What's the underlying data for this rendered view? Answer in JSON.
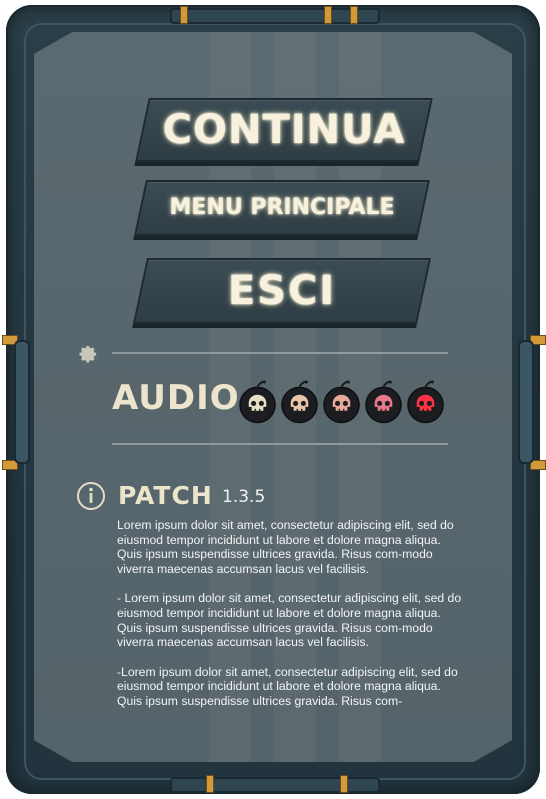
{
  "menu": {
    "continue_label": "CONTINUA",
    "main_menu_label": "MENU PRINCIPALE",
    "exit_label": "ESCI"
  },
  "settings": {
    "icon": "gear-icon",
    "audio_label": "AUDIO",
    "audio_level": 5,
    "audio_max": 5,
    "skull_colors": [
      "#e7dfc3",
      "#e9c6a8",
      "#e8a898",
      "#e8788a",
      "#ff3344"
    ]
  },
  "patch": {
    "icon": "info-icon",
    "title": "PATCH",
    "version": "1.3.5",
    "notes": [
      "Lorem ipsum dolor sit amet, consectetur adipiscing elit, sed do eiusmod tempor incididunt ut labore et dolore magna aliqua. Quis ipsum suspendisse ultrices gravida. Risus com-modo viverra maecenas accumsan lacus vel facilisis.",
      "- Lorem ipsum dolor sit amet, consectetur adipiscing elit, sed do eiusmod tempor incididunt ut labore et dolore magna aliqua. Quis ipsum suspendisse ultrices gravida. Risus com-modo viverra maecenas accumsan lacus vel facilisis.",
      "-Lorem ipsum dolor sit amet, consectetur adipiscing elit, sed do eiusmod tempor incididunt ut labore et dolore magna aliqua. Quis ipsum suspendisse ultrices gravida. Risus com-"
    ]
  }
}
